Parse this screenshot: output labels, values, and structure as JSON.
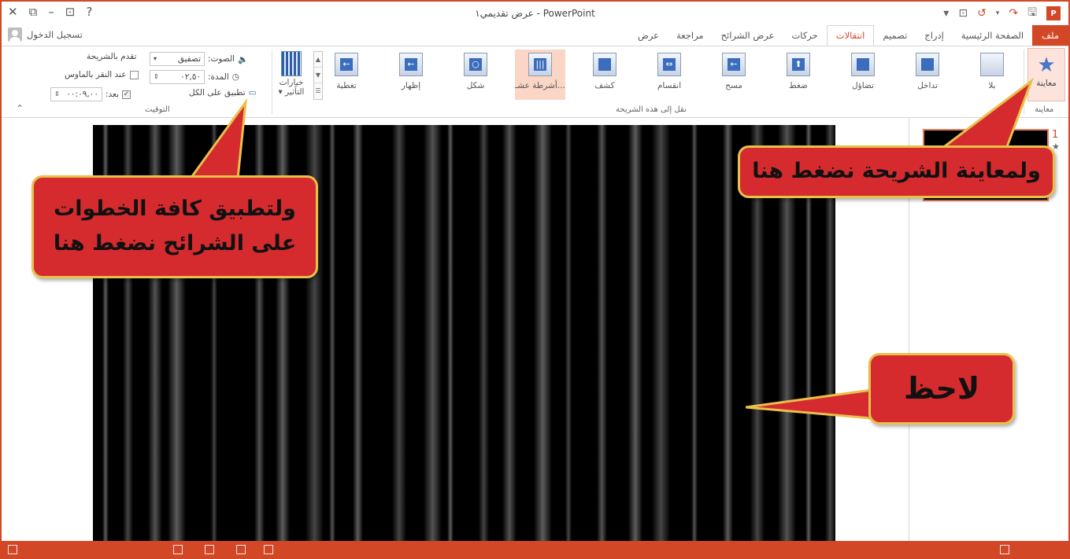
{
  "titlebar": {
    "title": "عرض تقديمي١ - PowerPoint",
    "left_icons": [
      "close-icon",
      "restore-icon",
      "minimize-icon",
      "ribbon-options-icon",
      "help-icon"
    ],
    "right_icons": [
      "powerpoint-logo-icon",
      "save-icon",
      "redo-icon",
      "undo-icon",
      "start-from-beginning-icon",
      "customize-qat-icon"
    ]
  },
  "tabs": [
    {
      "label": "ملف",
      "state": "file"
    },
    {
      "label": "الصفحة الرئيسية",
      "state": "normal"
    },
    {
      "label": "إدراج",
      "state": "normal"
    },
    {
      "label": "تصميم",
      "state": "normal"
    },
    {
      "label": "انتقالات",
      "state": "active"
    },
    {
      "label": "حركات",
      "state": "normal"
    },
    {
      "label": "عرض الشرائح",
      "state": "normal"
    },
    {
      "label": "مراجعة",
      "state": "normal"
    },
    {
      "label": "عرض",
      "state": "normal"
    }
  ],
  "signin": "تسجيل الدخول",
  "ribbon": {
    "preview": {
      "button": "معاينة",
      "group": "معاينة"
    },
    "transitions": {
      "group": "نقل إلى هذه الشريحة",
      "items": [
        {
          "label": "بلا",
          "glyph": ""
        },
        {
          "label": "تداخل",
          "glyph": ""
        },
        {
          "label": "تضاؤل",
          "glyph": ""
        },
        {
          "label": "ضغط",
          "glyph": "⬆"
        },
        {
          "label": "مسح",
          "glyph": "←"
        },
        {
          "label": "انقسام",
          "glyph": "⇔"
        },
        {
          "label": "كشف",
          "glyph": ""
        },
        {
          "label": "أشرطة عشـ...",
          "glyph": "|||"
        },
        {
          "label": "شكل",
          "glyph": "○"
        },
        {
          "label": "إظهار",
          "glyph": "←"
        },
        {
          "label": "تغطية",
          "glyph": "←"
        }
      ],
      "selected": "أشرطة عشـ..."
    },
    "effect_options": "خيارات التأثير",
    "timing": {
      "group": "التوقيت",
      "sound_label": "الصوت:",
      "sound_value": "تصفيق",
      "duration_label": "المدة:",
      "duration_value": "٠٢,٥٠",
      "apply_all": "تطبيق على الكل",
      "advance_label": "تقدم بالشريحة",
      "on_click": "عند النقر بالماوس",
      "after_label": "بعد:",
      "after_value": "٠٠:٠٩,٠٠"
    }
  },
  "slides_pane": {
    "number": "1",
    "star": "★"
  },
  "callouts": {
    "apply_all": [
      "ولتطبيق كافة الخطوات",
      "على الشرائح نضغط هنا"
    ],
    "preview": "ولمعاينة الشريحة نضغط هنا",
    "notice": "لاحظ"
  },
  "colors": {
    "accent": "#d24726",
    "callout_fill": "#d52b2e",
    "callout_border": "#e8c04a"
  }
}
